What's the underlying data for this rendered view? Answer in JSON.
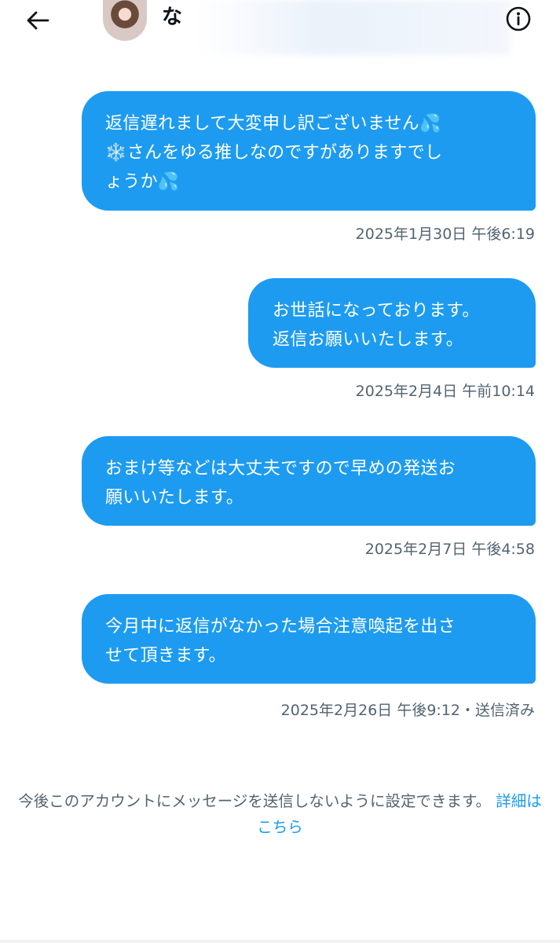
{
  "header": {
    "title": "な",
    "back_icon": "arrow-left-icon",
    "info_icon": "info-circle-icon"
  },
  "messages": [
    {
      "text": "返信遅れまして大変申し訳ございません💦\n❄️さんをゆる推しなのですがありますでし\nょうか💦",
      "timestamp": "2025年1月30日 午後6:19"
    },
    {
      "text": "お世話になっております。\n返信お願いいたします。",
      "timestamp": "2025年2月4日 午前10:14"
    },
    {
      "text": "おまけ等などは大丈夫ですので早めの発送お\n願いいたします。",
      "timestamp": "2025年2月7日 午後4:58"
    },
    {
      "text": "今月中に返信がなかった場合注意喚起を出さ\nせて頂きます。",
      "timestamp": "2025年2月26日 午後9:12・送信済み"
    }
  ],
  "footer": {
    "note": "今後このアカウントにメッセージを送信しないように設定できます。",
    "link": "詳細はこちら"
  },
  "colors": {
    "accent": "#1d9bf0",
    "secondary_text": "#536471",
    "primary_text": "#0f1419"
  }
}
